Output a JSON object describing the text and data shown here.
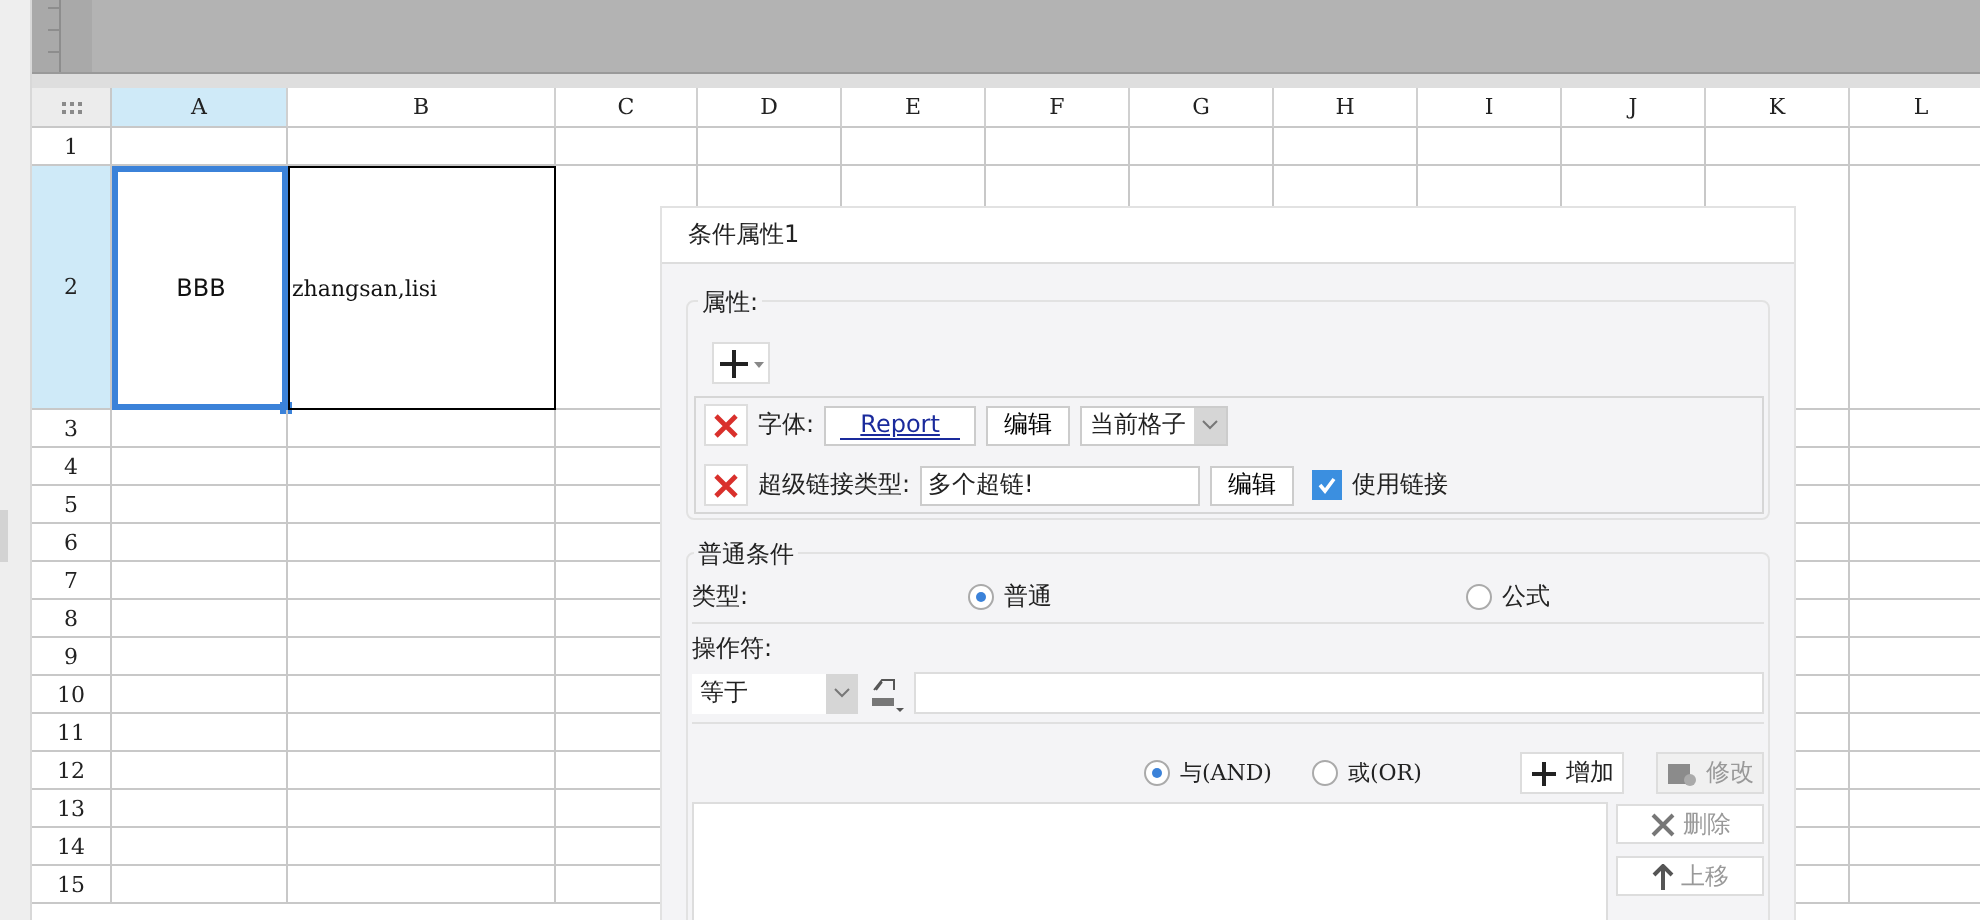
{
  "sheet": {
    "columns": [
      {
        "label": "A",
        "selected": true
      },
      {
        "label": "B",
        "selected": false
      },
      {
        "label": "C",
        "selected": false
      },
      {
        "label": "D",
        "selected": false
      },
      {
        "label": "E",
        "selected": false
      },
      {
        "label": "F",
        "selected": false
      },
      {
        "label": "G",
        "selected": false
      },
      {
        "label": "H",
        "selected": false
      },
      {
        "label": "I",
        "selected": false
      },
      {
        "label": "J",
        "selected": false
      },
      {
        "label": "K",
        "selected": false
      },
      {
        "label": "L",
        "selected": false
      }
    ],
    "rows": [
      {
        "label": "1",
        "selected": false,
        "bordered": false,
        "cells": []
      },
      {
        "label": "2",
        "selected": true,
        "bordered": true,
        "cells": [
          "BBB",
          "zhangsan,lisi"
        ]
      },
      {
        "label": "3",
        "selected": false,
        "bordered": false,
        "cells": []
      },
      {
        "label": "4",
        "selected": false,
        "bordered": false,
        "cells": []
      },
      {
        "label": "5",
        "selected": false,
        "bordered": false,
        "cells": []
      },
      {
        "label": "6",
        "selected": false,
        "bordered": false,
        "cells": []
      },
      {
        "label": "7",
        "selected": false,
        "bordered": false,
        "cells": []
      },
      {
        "label": "8",
        "selected": false,
        "bordered": false,
        "cells": []
      },
      {
        "label": "9",
        "selected": false,
        "bordered": false,
        "cells": []
      },
      {
        "label": "10",
        "selected": false,
        "bordered": false,
        "cells": []
      },
      {
        "label": "11",
        "selected": false,
        "bordered": false,
        "cells": []
      },
      {
        "label": "12",
        "selected": false,
        "bordered": false,
        "cells": []
      },
      {
        "label": "13",
        "selected": false,
        "bordered": false,
        "cells": []
      },
      {
        "label": "14",
        "selected": false,
        "bordered": false,
        "cells": []
      },
      {
        "label": "15",
        "selected": false,
        "bordered": false,
        "cells": []
      }
    ]
  },
  "dialog": {
    "title": "条件属性1",
    "properties": {
      "legend": "属性:",
      "items": [
        {
          "kind": "font",
          "label": "字体:",
          "preview": "Report",
          "button": "编辑",
          "select": "当前格子"
        },
        {
          "kind": "hyperlink",
          "label": "超级链接类型:",
          "value": "多个超链!",
          "button": "编辑",
          "checkbox": {
            "label": "使用链接",
            "checked": true
          }
        }
      ]
    },
    "condition": {
      "legend": "普通条件",
      "type_label": "类型:",
      "types": [
        {
          "label": "普通",
          "selected": true
        },
        {
          "label": "公式",
          "selected": false
        }
      ],
      "operator_label": "操作符:",
      "operator": "等于",
      "logic": [
        {
          "label": "与(AND)",
          "selected": true
        },
        {
          "label": "或(OR)",
          "selected": false
        }
      ],
      "actions": [
        {
          "kind": "plus",
          "label": "增加",
          "disabled": false
        },
        {
          "kind": "gear",
          "label": "修改",
          "disabled": true
        }
      ],
      "side_buttons": [
        {
          "kind": "cross",
          "label": "删除",
          "disabled": true
        },
        {
          "kind": "up",
          "label": "上移",
          "disabled": true
        }
      ]
    }
  }
}
